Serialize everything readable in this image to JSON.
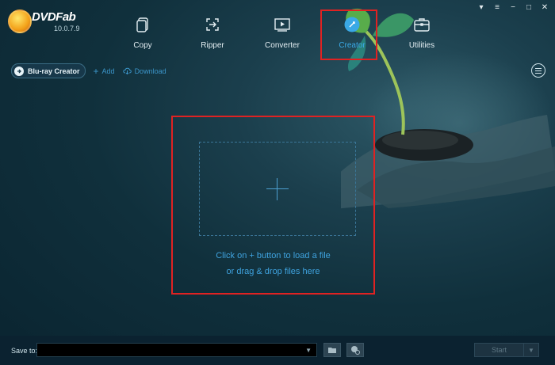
{
  "app": {
    "name": "DVDFab",
    "version": "10.0.7.9"
  },
  "window_controls": [
    "pin-icon",
    "dropdown-icon",
    "minimize-icon",
    "maximize-icon",
    "close-icon"
  ],
  "nav": {
    "items": [
      {
        "label": "Copy",
        "icon": "copy-icon"
      },
      {
        "label": "Ripper",
        "icon": "ripper-icon"
      },
      {
        "label": "Converter",
        "icon": "converter-icon"
      },
      {
        "label": "Creator",
        "icon": "creator-icon",
        "active": true
      },
      {
        "label": "Utilities",
        "icon": "utilities-icon"
      }
    ]
  },
  "toolbar": {
    "mode_label": "Blu-ray Creator",
    "add_label": "Add",
    "download_label": "Download"
  },
  "dropzone": {
    "hint_line1": "Click on + button to load a file",
    "hint_line2": "or drag & drop files here"
  },
  "bottom": {
    "save_label": "Save to:",
    "save_value": "",
    "start_label": "Start"
  },
  "colors": {
    "accent": "#3aa9e6",
    "highlight": "#e02222",
    "background": "#10303c"
  }
}
